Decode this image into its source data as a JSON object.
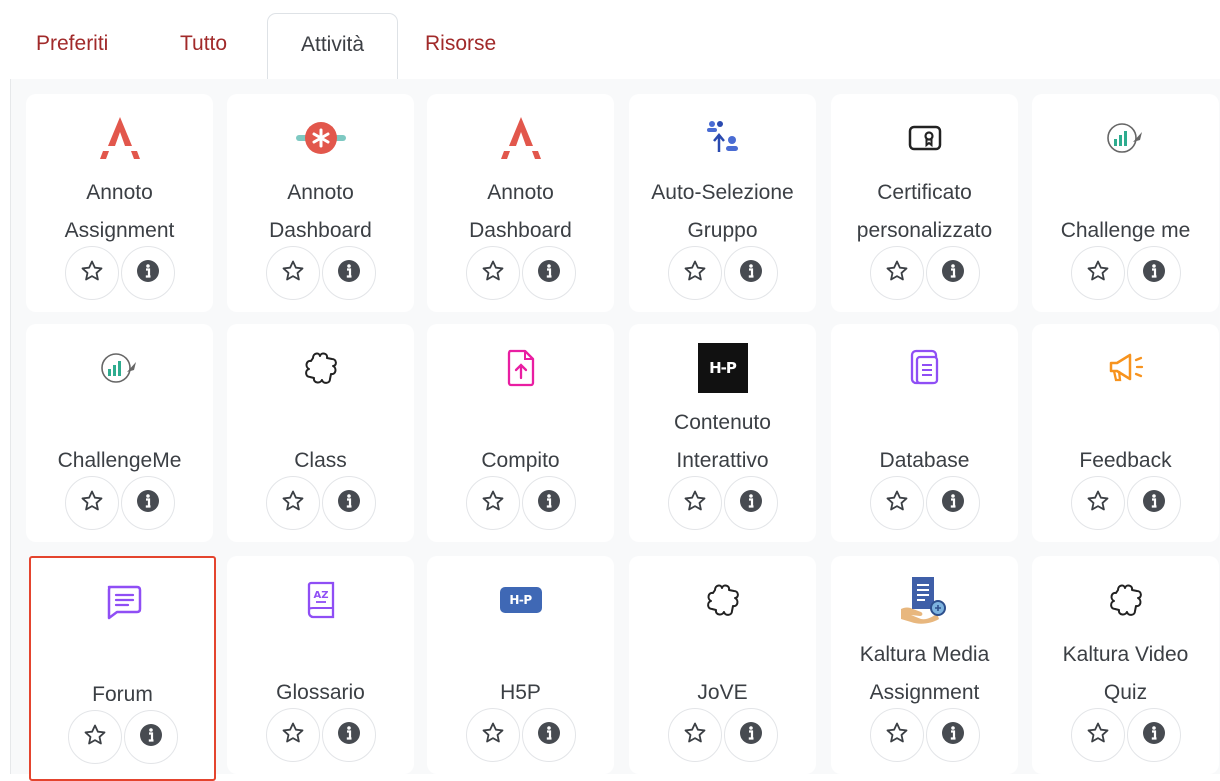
{
  "tabs": [
    {
      "label": "Preferiti"
    },
    {
      "label": "Tutto"
    },
    {
      "label": "Attività"
    },
    {
      "label": "Risorse"
    }
  ],
  "modules": [
    {
      "lines": [
        "Annoto",
        "Assignment"
      ],
      "icon": "annoto-logo-icon"
    },
    {
      "lines": [
        "Annoto",
        "Dashboard"
      ],
      "icon": "annoto-dashboard-icon"
    },
    {
      "lines": [
        "Annoto",
        "Dashboard"
      ],
      "icon": "annoto-logo-icon"
    },
    {
      "lines": [
        "Auto-Selezione",
        "Gruppo"
      ],
      "icon": "group-selection-icon"
    },
    {
      "lines": [
        "Certificato",
        "personalizzato"
      ],
      "icon": "certificate-icon"
    },
    {
      "lines": [
        "Challenge me"
      ],
      "icon": "challenge-me-icon"
    },
    {
      "lines": [
        "ChallengeMe"
      ],
      "icon": "challenge-me-icon"
    },
    {
      "lines": [
        "Class"
      ],
      "icon": "puzzle-icon"
    },
    {
      "lines": [
        "Compito"
      ],
      "icon": "assignment-upload-icon"
    },
    {
      "lines": [
        "Contenuto",
        "Interattivo"
      ],
      "icon": "h5p-icon"
    },
    {
      "lines": [
        "Database"
      ],
      "icon": "database-icon"
    },
    {
      "lines": [
        "Feedback"
      ],
      "icon": "megaphone-icon"
    },
    {
      "lines": [
        "Forum"
      ],
      "icon": "forum-chat-icon",
      "selected": true
    },
    {
      "lines": [
        "Glossario"
      ],
      "icon": "glossary-book-icon"
    },
    {
      "lines": [
        "H5P"
      ],
      "icon": "h5p-icon"
    },
    {
      "lines": [
        "JoVE"
      ],
      "icon": "puzzle-icon"
    },
    {
      "lines": [
        "Kaltura Media",
        "Assignment"
      ],
      "icon": "kaltura-assignment-icon"
    },
    {
      "lines": [
        "Kaltura Video",
        "Quiz"
      ],
      "icon": "puzzle-icon"
    }
  ],
  "buttons": {
    "favourite": "star-icon",
    "info": "info-icon"
  },
  "colors": {
    "tab_link": "#a12a2a",
    "tab_active": "#3c3f44",
    "selected_outline": "#e4442e",
    "annoto": "#e2574c",
    "purple": "#8f4ef5",
    "magenta": "#e91ea2",
    "orange": "#f7931e",
    "h5p_blue": "#3f68b5"
  },
  "h5p_text": "H-P"
}
